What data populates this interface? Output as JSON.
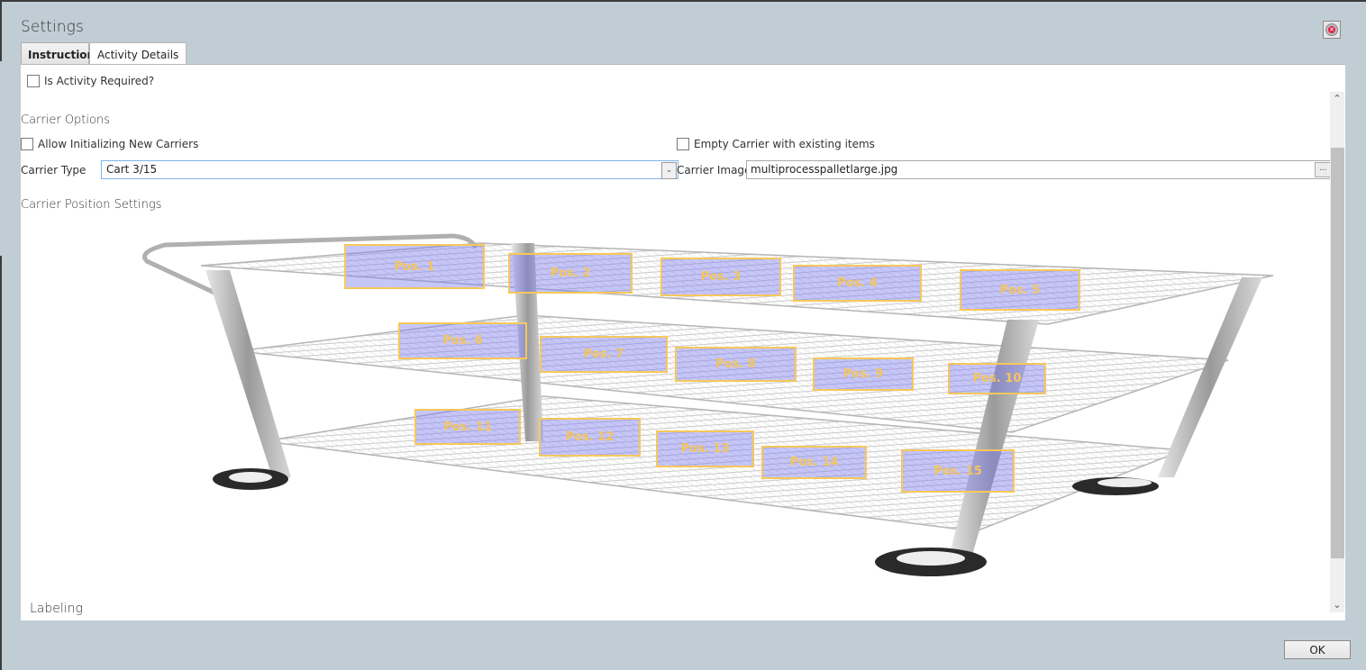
{
  "window": {
    "title": "Settings",
    "close_icon": "close-circle-icon"
  },
  "tabs": [
    {
      "label": "Instruction",
      "active": false
    },
    {
      "label": "Activity Details",
      "active": true
    }
  ],
  "activity": {
    "required_label": "Is Activity Required?",
    "required_checked": false
  },
  "carrier_options": {
    "heading": "Carrier Options",
    "allow_init_label": "Allow Initializing New Carriers",
    "allow_init_checked": false,
    "empty_carrier_label": "Empty Carrier with existing items",
    "empty_carrier_checked": false,
    "type_label": "Carrier Type",
    "type_value": "Cart 3/15",
    "image_label": "Carrier Image:",
    "image_value": "multiprocesspalletlarge.jpg",
    "browse_label": "...",
    "dropdown_icon": "chevron-down-icon"
  },
  "position_settings": {
    "heading": "Carrier Position Settings",
    "positions": [
      "Pos. 1",
      "Pos. 2",
      "Pos. 3",
      "Pos. 4",
      "Pos. 5",
      "Pos. 6",
      "Pos. 7",
      "Pos. 8",
      "Pos. 9",
      "Pos. 10",
      "Pos. 11",
      "Pos. 12",
      "Pos. 13",
      "Pos. 14",
      "Pos. 15"
    ]
  },
  "labeling": {
    "heading": "Labeling"
  },
  "scrollbar": {
    "up_icon": "chevron-up-icon",
    "down_icon": "chevron-down-icon"
  },
  "footer": {
    "ok_label": "OK"
  },
  "colors": {
    "highlight_border": "#f7c85a",
    "highlight_fill": "#7878f0",
    "backdrop": "#c1cdd5"
  }
}
